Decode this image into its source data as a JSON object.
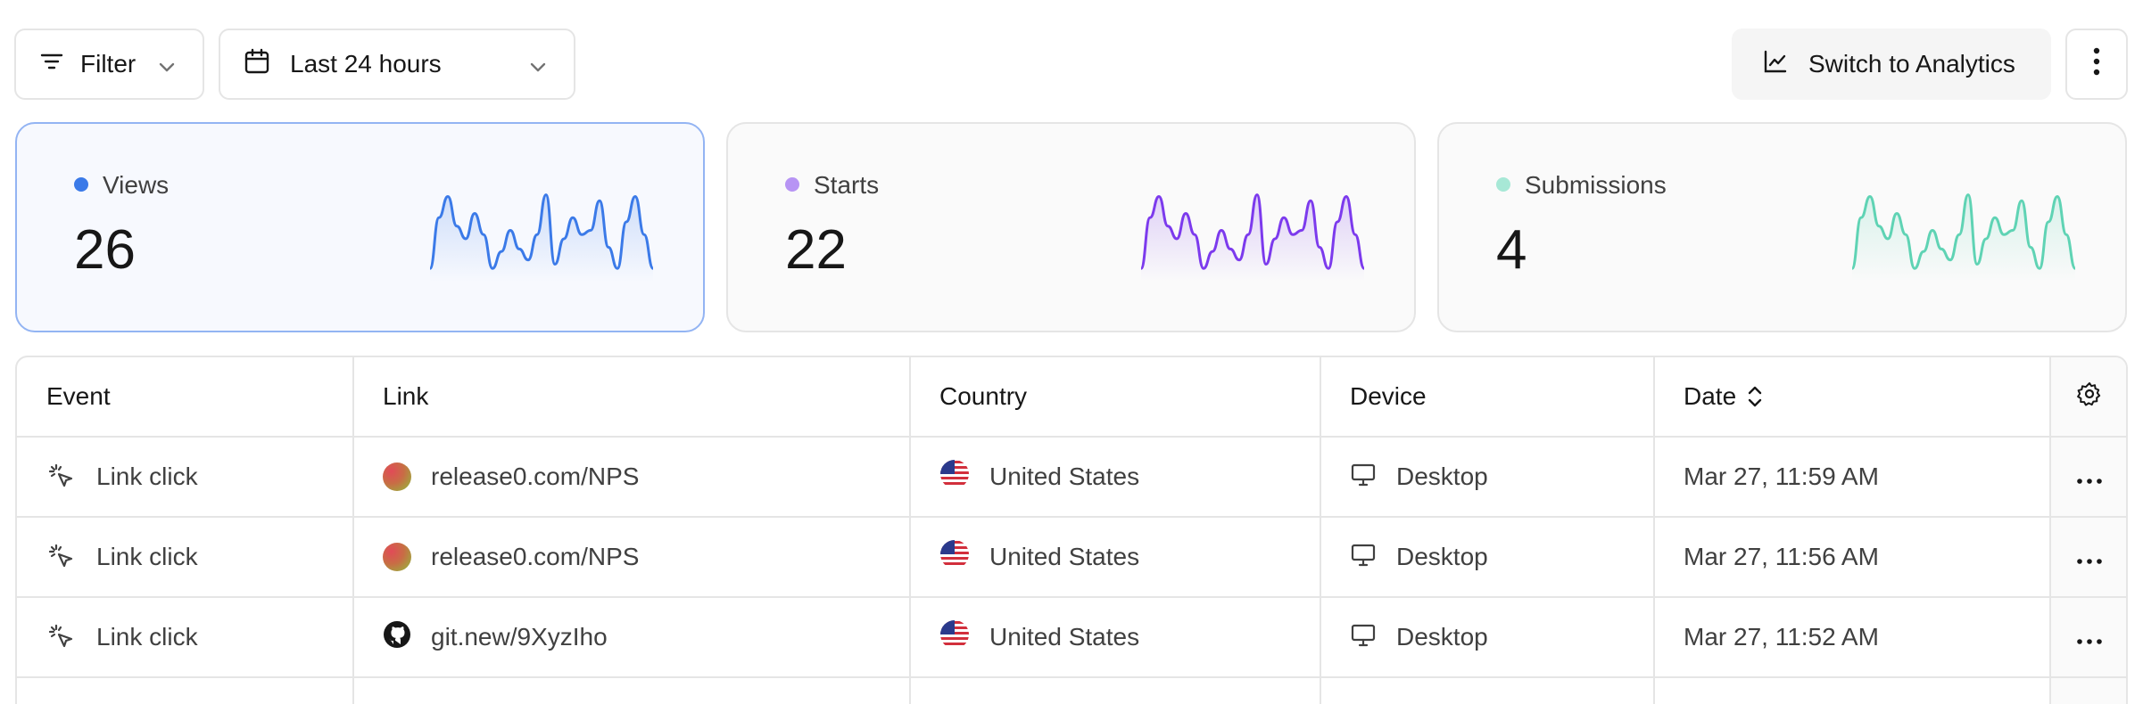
{
  "toolbar": {
    "filter_label": "Filter",
    "date_range_label": "Last 24 hours",
    "switch_label": "Switch to Analytics"
  },
  "metrics": [
    {
      "label": "Views",
      "value": "26",
      "color": "#3b7ae8"
    },
    {
      "label": "Starts",
      "value": "22",
      "color": "#7c3aed"
    },
    {
      "label": "Submissions",
      "value": "4",
      "color": "#5fd3b4"
    }
  ],
  "table": {
    "columns": [
      "Event",
      "Link",
      "Country",
      "Device",
      "Date"
    ],
    "rows": [
      {
        "event": "Link click",
        "link": "release0.com/NPS",
        "link_icon": "gradient-avatar",
        "country": "United States",
        "device": "Desktop",
        "date": "Mar 27, 11:59 AM"
      },
      {
        "event": "Link click",
        "link": "release0.com/NPS",
        "link_icon": "gradient-avatar",
        "country": "United States",
        "device": "Desktop",
        "date": "Mar 27, 11:56 AM"
      },
      {
        "event": "Link click",
        "link": "git.new/9XyzIho",
        "link_icon": "github-icon",
        "country": "United States",
        "device": "Desktop",
        "date": "Mar 27, 11:52 AM"
      }
    ]
  }
}
